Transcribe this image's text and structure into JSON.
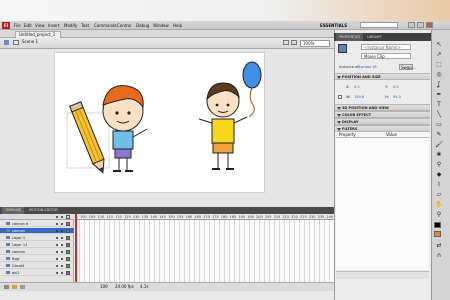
{
  "app": {
    "logo": "Fl",
    "workspace": "ESSENTIALS"
  },
  "menu": [
    "File",
    "Edit",
    "View",
    "Insert",
    "Modify",
    "Text",
    "Commands",
    "Control",
    "Debug",
    "Window",
    "Help"
  ],
  "document": {
    "tab_label": "Untitled_project_1",
    "scene": "Scene 1",
    "zoom": "100%"
  },
  "properties": {
    "tabs": [
      "PROPERTIES",
      "LIBRARY"
    ],
    "instance_name_placeholder": "<Instance Name>",
    "symbol_type": "Movie Clip",
    "instance_of_label": "Instance of:",
    "instance_of_value": "Symbol 18",
    "swap_label": "Swap...",
    "sections": [
      "POSITION AND SIZE",
      "3D POSITION AND VIEW",
      "COLOR EFFECT",
      "DISPLAY",
      "FILTERS"
    ],
    "position": {
      "x_label": "X:",
      "x": "0.0",
      "y_label": "Y:",
      "y": "0.0",
      "w_label": "W:",
      "w": "159.6",
      "h_label": "H:",
      "h": "95.0"
    },
    "filters_cols": [
      "Property",
      "Value"
    ]
  },
  "timeline": {
    "tabs": [
      "TIMELINE",
      "MOTION EDITOR"
    ],
    "ruler": [
      "100",
      "105",
      "110",
      "115",
      "120",
      "125",
      "130",
      "135",
      "140",
      "145",
      "150",
      "155",
      "160",
      "165",
      "170",
      "175",
      "180",
      "185",
      "190",
      "195",
      "200",
      "205",
      "210",
      "215",
      "220",
      "225",
      "230",
      "235",
      "240"
    ],
    "layers": [
      {
        "name": "cannon b",
        "color": "#e05a5a",
        "selected": false
      },
      {
        "name": "cannon",
        "color": "#2e7de0",
        "selected": true
      },
      {
        "name": "Layer 1",
        "color": "#26b64a",
        "selected": false
      },
      {
        "name": "Layer 13",
        "color": "#b64ad8",
        "selected": false
      },
      {
        "name": "cannon",
        "color": "#26b64a",
        "selected": false
      },
      {
        "name": "flygi",
        "color": "#26b64a",
        "selected": false
      },
      {
        "name": "Cloud4",
        "color": "#26b64a",
        "selected": false
      },
      {
        "name": "ani2",
        "color": "#b64ad8",
        "selected": false
      }
    ],
    "footer": {
      "frame": "100",
      "fps": "24.00 fps",
      "time": "4.1s"
    }
  }
}
